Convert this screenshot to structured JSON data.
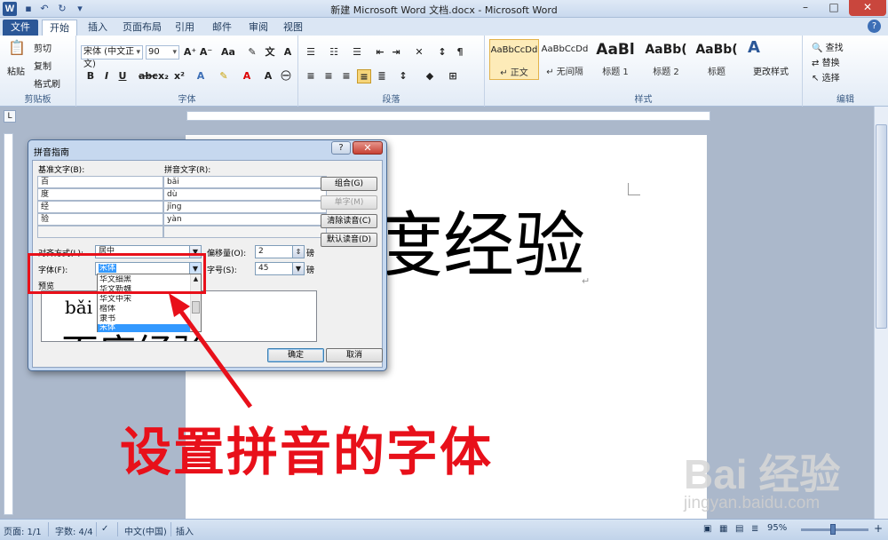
{
  "window": {
    "title": "新建 Microsoft Word 文档.docx - Microsoft Word",
    "app_icon": "W",
    "minimize": "–",
    "maximize": "□",
    "close": "✕"
  },
  "tabs": [
    "文件",
    "开始",
    "插入",
    "页面布局",
    "引用",
    "邮件",
    "审阅",
    "视图"
  ],
  "ribbon": {
    "clipboard": {
      "label": "剪贴板",
      "paste": "粘贴",
      "cut": "剪切",
      "copy": "复制",
      "format_painter": "格式刷"
    },
    "font": {
      "label": "字体",
      "font_name": "宋体 (中文正文)",
      "font_size": "90"
    },
    "paragraph": {
      "label": "段落"
    },
    "styles": {
      "label": "样式",
      "items": [
        {
          "sample": "AaBbCcDd",
          "name": "↵ 正文"
        },
        {
          "sample": "AaBbCcDd",
          "name": "↵ 无间隔"
        },
        {
          "sample": "AaBl",
          "name": "标题 1"
        },
        {
          "sample": "AaBb(",
          "name": "标题 2"
        },
        {
          "sample": "AaBb(",
          "name": "标题"
        }
      ],
      "change_styles": "更改样式"
    },
    "editing": {
      "label": "编辑",
      "find": "查找",
      "replace": "替换",
      "select": "选择"
    }
  },
  "document": {
    "text": "度经验"
  },
  "dialog": {
    "title": "拼音指南",
    "help": "?",
    "close": "✕",
    "base_text_label": "基准文字(B):",
    "ruby_text_label": "拼音文字(R):",
    "rows": [
      {
        "base": "百",
        "ruby": "bǎi"
      },
      {
        "base": "度",
        "ruby": "dù"
      },
      {
        "base": "经",
        "ruby": "jīng"
      },
      {
        "base": "验",
        "ruby": "yàn"
      },
      {
        "base": "",
        "ruby": ""
      }
    ],
    "buttons": {
      "group": "组合(G)",
      "single": "单字(M)",
      "clear": "清除读音(C)",
      "default": "默认读音(D)",
      "ok": "确定",
      "cancel": "取消"
    },
    "alignment_label": "对齐方式(L):",
    "alignment_value": "居中",
    "offset_label": "偏移量(O):",
    "offset_value": "2",
    "offset_unit": "磅",
    "font_label": "字体(F):",
    "font_value": "宋体",
    "size_label": "字号(S):",
    "size_value": "45",
    "size_unit": "磅",
    "preview_label": "预览",
    "preview_pinyin": "bǎi dù jīng yàn",
    "preview_base": "百度经验",
    "font_options": [
      "华文细黑",
      "华文新魏",
      "华文中宋",
      "楷体",
      "隶书",
      "宋体"
    ]
  },
  "annotation": "设置拼音的字体",
  "watermark": {
    "logo": "Bai 经验",
    "url": "jingyan.baidu.com"
  },
  "statusbar": {
    "page": "页面: 1/1",
    "words": "字数: 4/4",
    "language": "中文(中国)",
    "mode": "插入",
    "zoom": "95%"
  },
  "colors": {
    "annotation_red": "#e8101a",
    "file_tab": "#2b5797",
    "selection_blue": "#3399ff"
  }
}
